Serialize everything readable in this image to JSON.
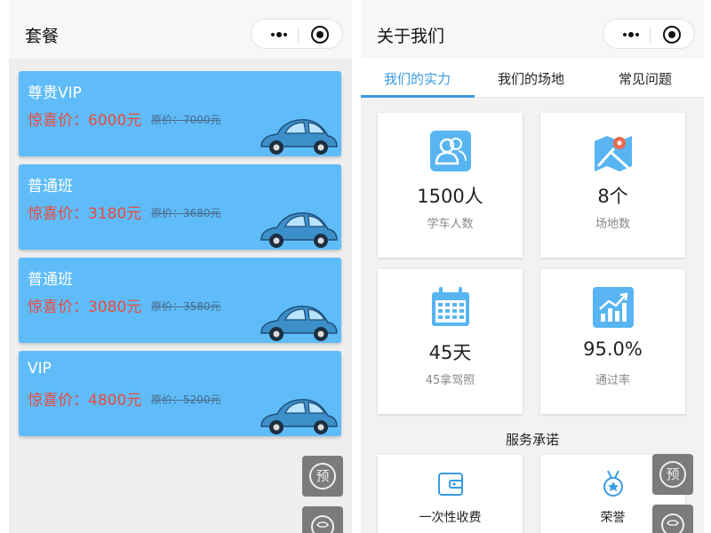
{
  "left": {
    "title": "套餐",
    "packages": [
      {
        "name": "尊贵VIP",
        "price": "惊喜价：6000元",
        "original": "原价：7000元"
      },
      {
        "name": "普通班",
        "price": "惊喜价：3180元",
        "original": "原价：3680元"
      },
      {
        "name": "普通班",
        "price": "惊喜价：3080元",
        "original": "原价：3580元"
      },
      {
        "name": "VIP",
        "price": "惊喜价：4800元",
        "original": "原价：5200元"
      }
    ],
    "fab_label": "预"
  },
  "right": {
    "title": "关于我们",
    "tabs": [
      "我们的实力",
      "我们的场地",
      "常见问题"
    ],
    "stats": [
      {
        "value": "1500人",
        "label": "学车人数",
        "icon": "users-icon"
      },
      {
        "value": "8个",
        "label": "场地数",
        "icon": "map-icon"
      },
      {
        "value": "45天",
        "label": "45拿驾照",
        "icon": "calendar-icon"
      },
      {
        "value": "95.0%",
        "label": "通过率",
        "icon": "chart-icon"
      }
    ],
    "service_title": "服务承诺",
    "services": [
      {
        "label": "一次性收费",
        "icon": "wallet-icon"
      },
      {
        "label": "荣誉",
        "icon": "medal-icon"
      }
    ],
    "fab_label": "预"
  },
  "colors": {
    "accent": "#3a9be0",
    "card": "#5fbcf9",
    "price": "#e94a3c"
  }
}
